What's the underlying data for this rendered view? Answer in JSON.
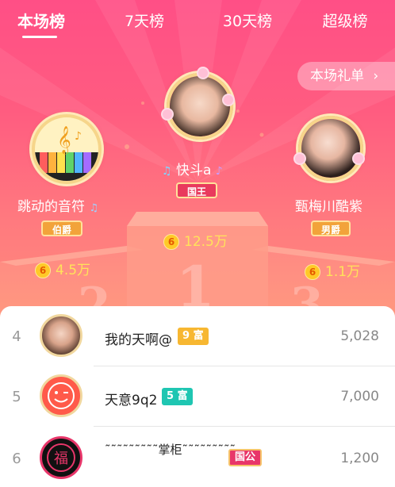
{
  "tabs": [
    {
      "label": "本场榜",
      "active": true
    },
    {
      "label": "7天榜"
    },
    {
      "label": "30天榜"
    },
    {
      "label": "超级榜"
    }
  ],
  "gift_button": {
    "label": "本场礼单",
    "chevron": "›"
  },
  "podium": {
    "numbers": [
      "1",
      "2",
      "3"
    ],
    "first": {
      "name": "快斗a",
      "badge": "国王",
      "score": "12.5万",
      "note_icon": "music-note-icon"
    },
    "second": {
      "name": "跳动的音符",
      "badge": "伯爵",
      "score": "4.5万"
    },
    "third": {
      "name": "甄梅川酷紫",
      "badge": "男爵",
      "score": "1.1万"
    }
  },
  "coin_glyph": "6",
  "rows": [
    {
      "rank": "4",
      "name": "我的天啊@",
      "level": "9 富",
      "level_color": "#f7b731",
      "score": "5,028"
    },
    {
      "rank": "5",
      "name": "天意9q2",
      "level": "5 富",
      "level_color": "#1fc6b2",
      "score": "7,000"
    },
    {
      "rank": "6",
      "name": "˜˜˜˜˜˜˜˜˜掌柜˜˜˜˜˜˜˜˜˜",
      "level": "国公",
      "level_color": "#e8366a",
      "score": "1,200"
    }
  ],
  "colors": {
    "accent": "#ff5a84",
    "gold": "#ffe35a"
  }
}
